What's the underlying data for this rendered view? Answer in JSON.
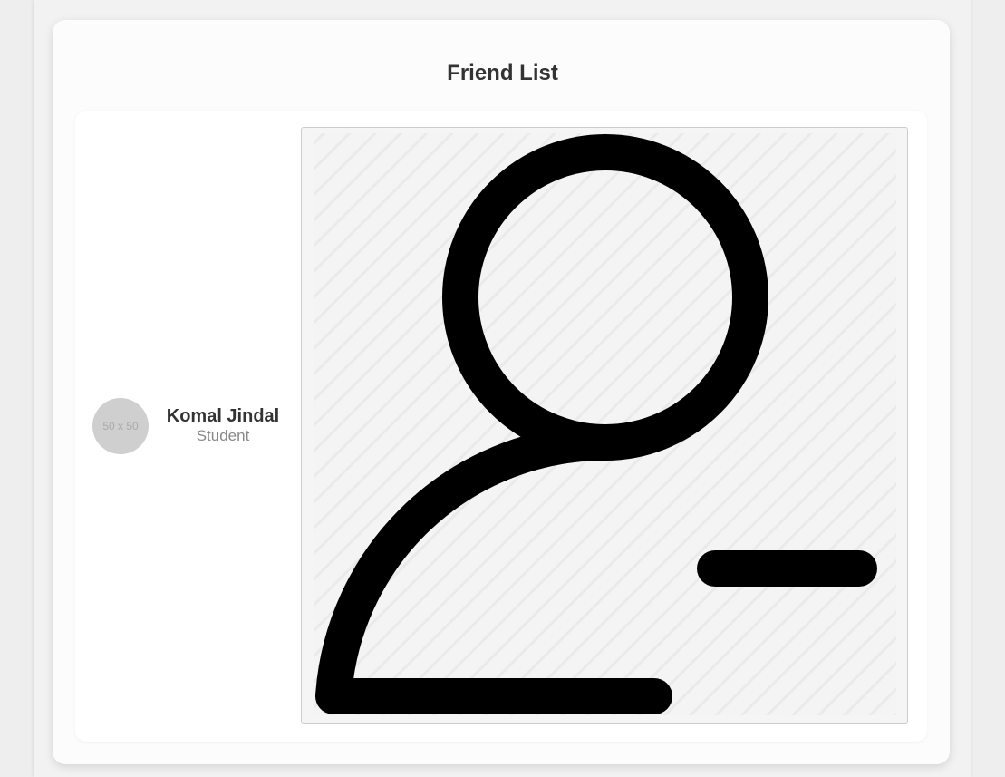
{
  "header": {
    "title": "Friend List"
  },
  "friends": [
    {
      "avatar_placeholder": "50 x 50",
      "name": "Komal Jindal",
      "role": "Student",
      "action_icon": "user-minus-icon"
    }
  ],
  "colors": {
    "background": "#eeeeee",
    "card": "#fcfcfc",
    "title_text": "#333333",
    "secondary_text": "#888888",
    "avatar": "#cfcfcf",
    "icon": "#000000"
  }
}
